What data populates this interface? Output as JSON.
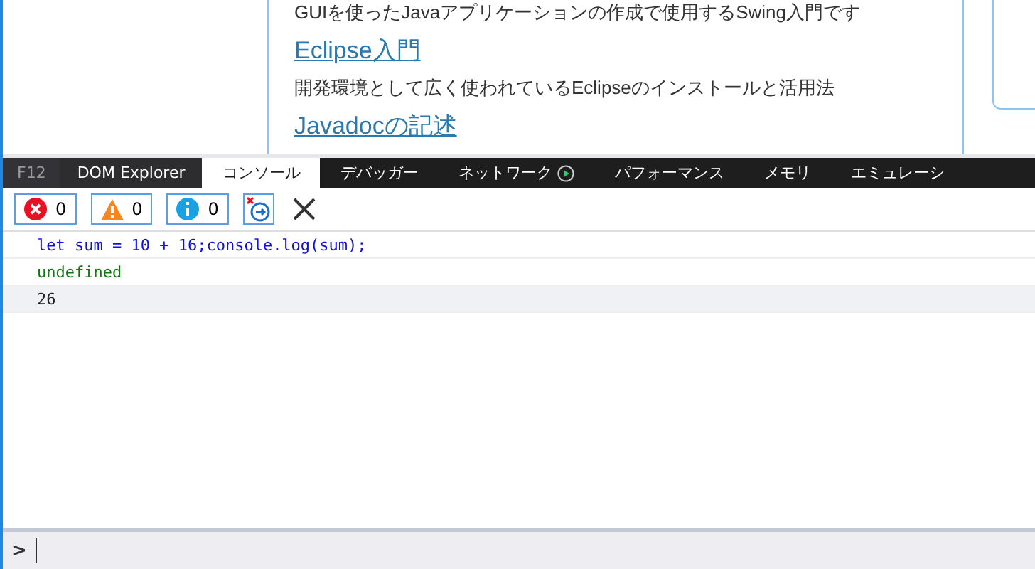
{
  "page": {
    "items": [
      {
        "kind": "text",
        "text": "GUIを使ったJavaアプリケーションの作成で使用するSwing入門です"
      },
      {
        "kind": "link",
        "text": "Eclipse入門"
      },
      {
        "kind": "text",
        "text": "開発環境として広く使われているEclipseのインストールと活用法"
      },
      {
        "kind": "link",
        "text": "Javadocの記述"
      }
    ]
  },
  "devtools": {
    "f12": "F12",
    "tabs": [
      {
        "label": "DOM Explorer",
        "selected": false
      },
      {
        "label": "コンソール",
        "selected": true
      },
      {
        "label": "デバッガー",
        "selected": false
      },
      {
        "label": "ネットワーク",
        "selected": false,
        "play": true
      },
      {
        "label": "パフォーマンス",
        "selected": false
      },
      {
        "label": "メモリ",
        "selected": false
      },
      {
        "label": "エミュレーシ",
        "selected": false
      }
    ],
    "filters": [
      {
        "kind": "error",
        "count": "0"
      },
      {
        "kind": "warning",
        "count": "0"
      },
      {
        "kind": "info",
        "count": "0"
      }
    ],
    "console": [
      {
        "kind": "input",
        "text": "let sum = 10 + 16;console.log(sum);"
      },
      {
        "kind": "result",
        "text": "undefined"
      },
      {
        "kind": "log",
        "text": "26"
      }
    ],
    "prompt": ">"
  }
}
